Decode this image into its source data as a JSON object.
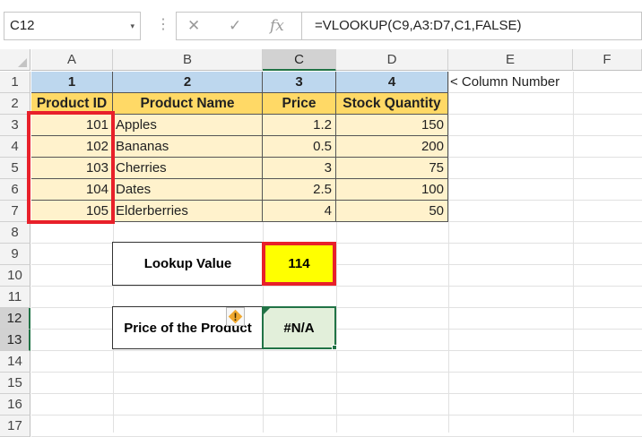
{
  "formula_bar": {
    "name_box": "C12",
    "dropdown_glyph": "▾",
    "dots_glyph": "⋮",
    "cancel_glyph": "✕",
    "enter_glyph": "✓",
    "fx_glyph": "fx",
    "formula": "=VLOOKUP(C9,A3:D7,C1,FALSE)"
  },
  "columns": [
    "A",
    "B",
    "C",
    "D",
    "E",
    "F"
  ],
  "rows": [
    "1",
    "2",
    "3",
    "4",
    "5",
    "6",
    "7",
    "8",
    "9",
    "10",
    "11",
    "12",
    "13",
    "14",
    "15",
    "16",
    "17"
  ],
  "sheet": {
    "col_numbers": [
      "1",
      "2",
      "3",
      "4"
    ],
    "col_note": "< Column Number",
    "headers": [
      "Product ID",
      "Product Name",
      "Price",
      "Stock Quantity"
    ],
    "data": [
      {
        "id": "101",
        "name": "Apples",
        "price": "1.2",
        "qty": "150"
      },
      {
        "id": "102",
        "name": "Bananas",
        "price": "0.5",
        "qty": "200"
      },
      {
        "id": "103",
        "name": "Cherries",
        "price": "3",
        "qty": "75"
      },
      {
        "id": "104",
        "name": "Dates",
        "price": "2.5",
        "qty": "100"
      },
      {
        "id": "105",
        "name": "Elderberries",
        "price": "4",
        "qty": "50"
      }
    ],
    "lookup_label": "Lookup Value",
    "lookup_value": "114",
    "result_label": "Price of the Product",
    "result_value": "#N/A",
    "warning_glyph": "!"
  },
  "colors": {
    "header_blue": "#bdd7ee",
    "header_gold": "#ffd966",
    "table_fill": "#fff2cc",
    "lookup_fill": "#ffff00",
    "highlight_red": "#e8202a",
    "result_fill": "#e2efda",
    "excel_green": "#217346"
  }
}
